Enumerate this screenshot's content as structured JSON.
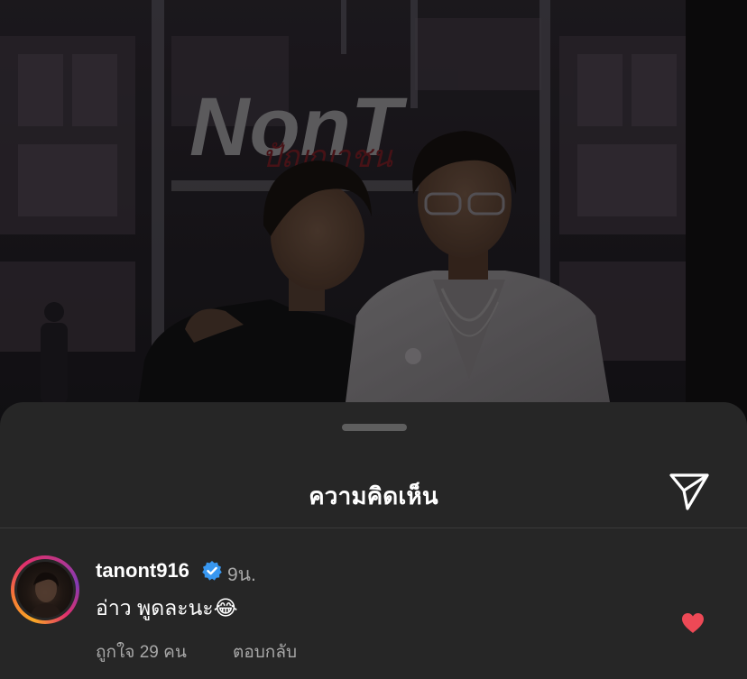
{
  "background_photo": {
    "sign_logo_text": "NonT",
    "sign_script_text": "ปัญญาชน"
  },
  "sheet": {
    "title": "ความคิดเห็น",
    "share_icon": "paper-plane-icon"
  },
  "comment": {
    "username": "tanont916",
    "verified_icon": "verified-badge-icon",
    "time": "9น.",
    "text": "อ่าว พูดละนะ",
    "emoji": "😂",
    "likes": "ถูกใจ 29 คน",
    "reply_label": "ตอบกลับ",
    "liked": true,
    "heart_icon": "heart-filled-icon"
  },
  "colors": {
    "sheet_bg": "#262626",
    "text_primary": "#ffffff",
    "text_secondary": "#a8a8a8",
    "verified_blue": "#3897f0",
    "heart_red": "#ed4956"
  }
}
